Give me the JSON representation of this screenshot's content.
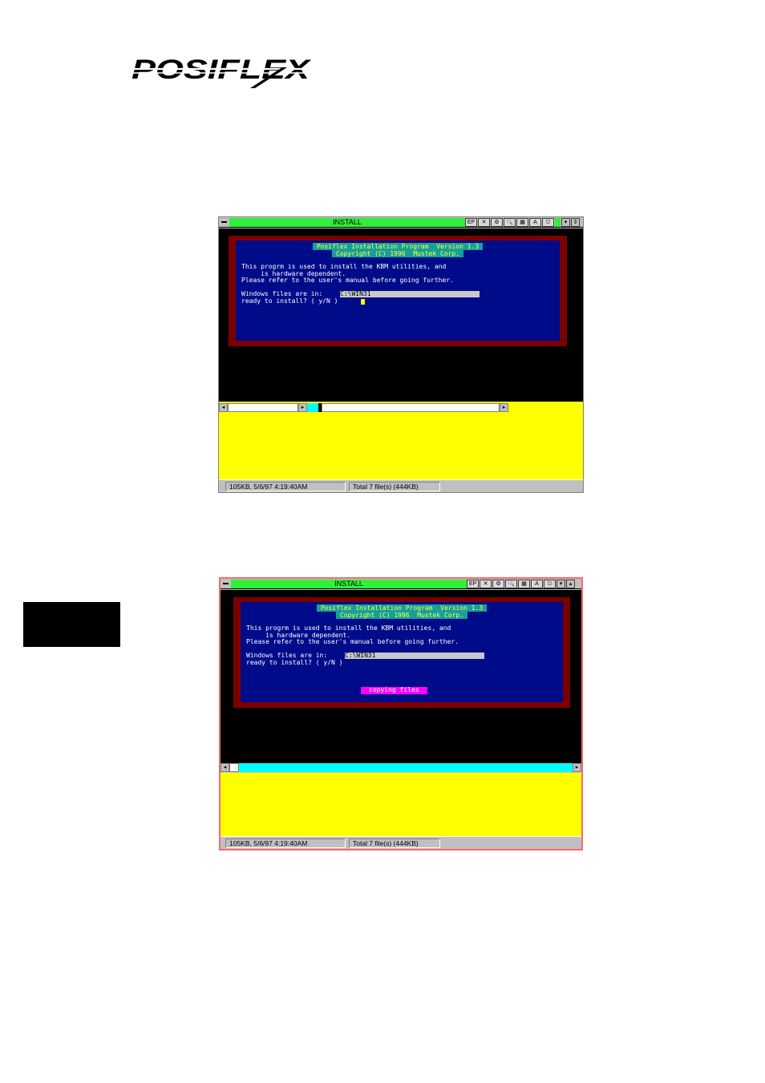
{
  "logo": {
    "text": "POSIFLEX"
  },
  "screenshots": [
    {
      "title": "INSTALL",
      "toolbar": [
        "EP",
        "✕",
        "⚙",
        "🔍",
        "▦",
        "A",
        "⎋"
      ],
      "banner_line1": "Posiflex Installation Program  Version 1.3",
      "banner_line2": "Copyright (C) 1996  Mustek Corp.",
      "body_line1": "This progrm is used to install the KBM utilities, and",
      "body_line2": "     is hardware dependent.",
      "body_line3": "Please refer to the user's manual before going further.",
      "files_label": "Windows files are in:",
      "files_path": "C:\\WIN31",
      "ready_prompt": "ready to install? ( y/N )",
      "status_left": "105KB, 5/6/97 4:19:40AM",
      "status_right": "Total 7 file(s) (444KB)"
    },
    {
      "title": "INSTALL",
      "toolbar": [
        "EP",
        "✕",
        "⚙",
        "🔍",
        "▦",
        "A",
        "⎋"
      ],
      "banner_line1": "Posiflex Installation Program  Version 1.3",
      "banner_line2": "Copyright (C) 1996  Mustek Corp.",
      "body_line1": "This progrm is used to install the KBM utilities, and",
      "body_line2": "     is hardware dependent.",
      "body_line3": "Please refer to the user's manual before going further.",
      "files_label": "Windows files are in:",
      "files_path": "C:\\WIN31",
      "ready_prompt": "ready to install? ( y/N )",
      "copying": "copying files",
      "status_left": "105KB, 5/6/97 4:19:40AM",
      "status_right": "Total 7 file(s) (444KB)"
    }
  ]
}
